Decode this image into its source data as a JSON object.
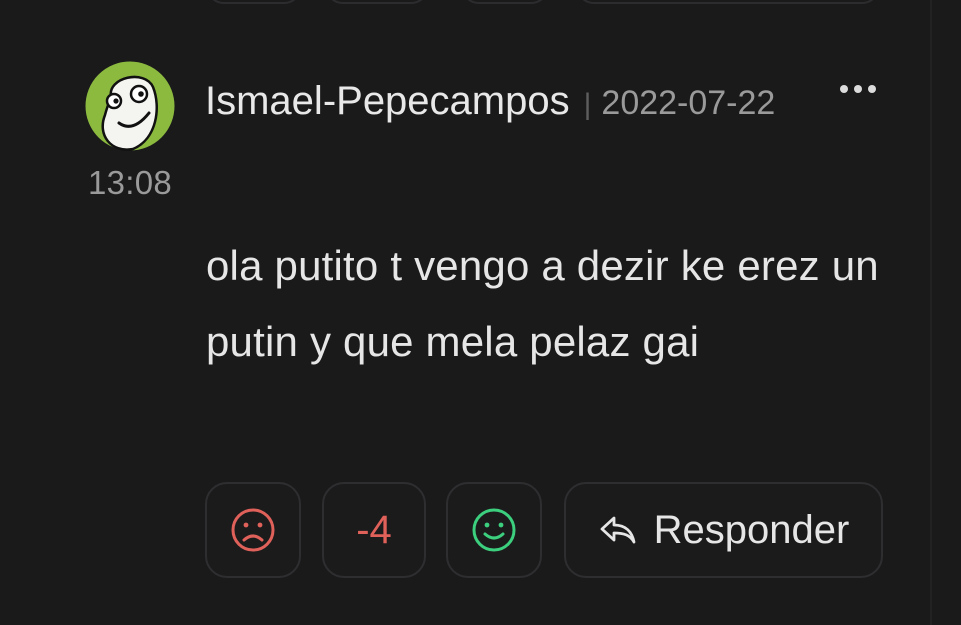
{
  "comment": {
    "author": "Ismael-Pepecampos",
    "separator": "|",
    "date": "2022-07-22",
    "time": "13:08",
    "text": "ola putito t vengo a dezir ke erez un putin y que mela pelaz gai"
  },
  "actions": {
    "downvote_icon": "sad-face-icon",
    "score": "-4",
    "upvote_icon": "smile-face-icon",
    "reply_icon": "reply-arrow-icon",
    "reply_label": "Responder"
  },
  "menu": {
    "more_icon": "more-dots-icon"
  },
  "colors": {
    "background": "#1a1a1b",
    "negative": "#e0605a",
    "positive": "#3ccf7e",
    "avatar_ring": "#8cba3f"
  }
}
